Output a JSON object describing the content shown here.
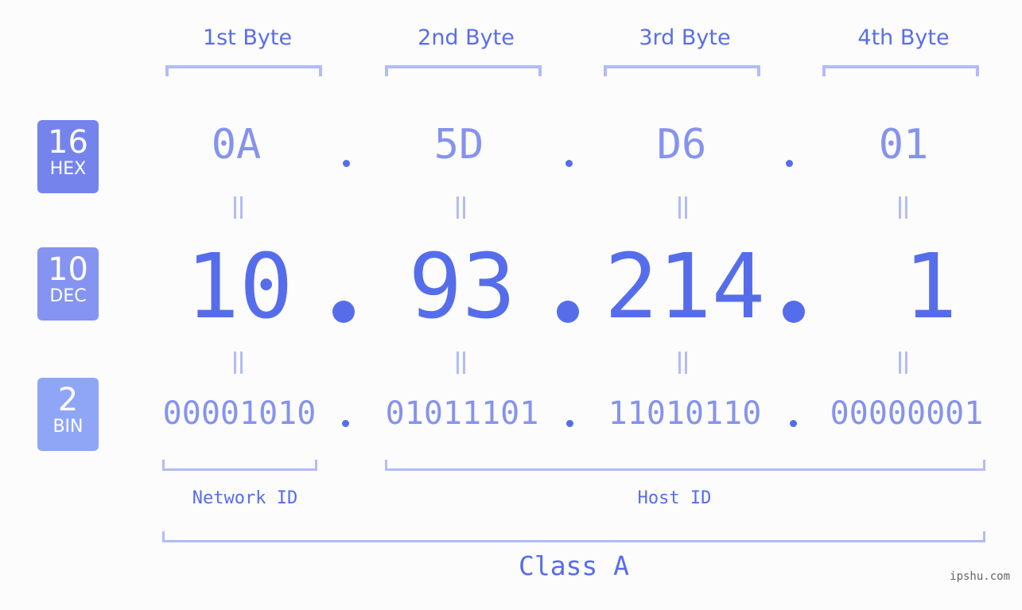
{
  "bytes": [
    {
      "label": "1st Byte",
      "hex": "0A",
      "dec": "10",
      "bin": "00001010"
    },
    {
      "label": "2nd Byte",
      "hex": "5D",
      "dec": "93",
      "bin": "01011101"
    },
    {
      "label": "3rd Byte",
      "hex": "D6",
      "dec": "214",
      "bin": "11010110"
    },
    {
      "label": "4th Byte",
      "hex": "01",
      "dec": "1",
      "bin": "00000001"
    }
  ],
  "badges": {
    "hex": {
      "base": "16",
      "name": "HEX",
      "color": "#7584ec"
    },
    "dec": {
      "base": "10",
      "name": "DEC",
      "color": "#8594f1"
    },
    "bin": {
      "base": "2",
      "name": "BIN",
      "color": "#8fa6f7"
    }
  },
  "separator": ".",
  "network_id_label": "Network ID",
  "host_id_label": "Host ID",
  "class_label": "Class A",
  "watermark": "ipshu.com",
  "colors": {
    "accent": "#566deb",
    "light_text": "#8593ee",
    "bracket": "#b3bcf7",
    "background": "#fbfcfb"
  }
}
